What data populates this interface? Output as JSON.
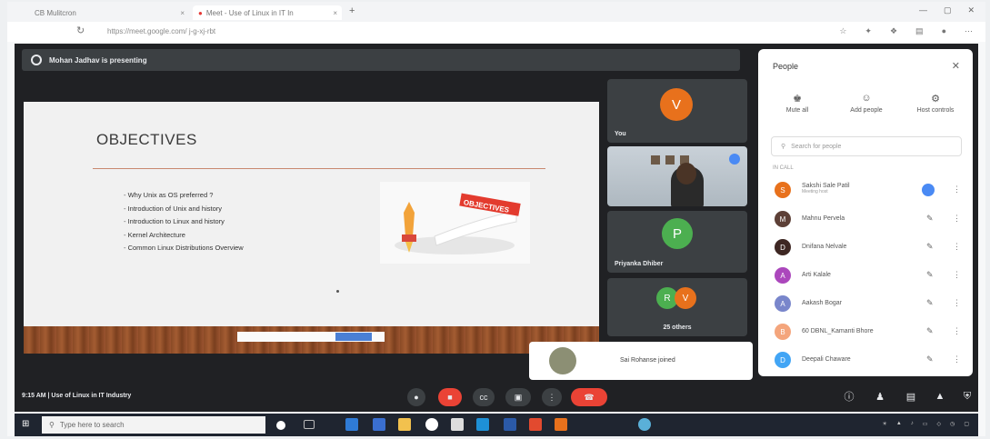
{
  "browser": {
    "tabs": [
      "CB Mulitcron",
      "Meet - Use of Linux in IT In"
    ],
    "address": "https://meet.google.com/ j-g-xj-rbt",
    "new_tab": "+"
  },
  "presenting": {
    "text": "Mohan Jadhav is presenting"
  },
  "slide": {
    "title": "OBJECTIVES",
    "bullets": [
      "Why Unix as OS preferred ?",
      "Introduction of Unix and history",
      "Introduction to Linux and history",
      "Kernel Architecture",
      "Common Linux Distributions Overview"
    ],
    "graphic_label": "OBJECTIVES"
  },
  "tiles": {
    "you": {
      "initial": "V",
      "label": "You",
      "color": "#e8711c"
    },
    "priyanka": {
      "initial": "P",
      "label": "Priyanka Dhiber",
      "color": "#4caf50"
    },
    "others": {
      "initials": [
        "R",
        "V"
      ],
      "colors": [
        "#4caf50",
        "#e8711c"
      ],
      "label": "25 others"
    }
  },
  "toast": {
    "text": "Sai Rohanse joined"
  },
  "footer": {
    "meeting": "9:15 AM  |  Use of Linux in IT Industry"
  },
  "people": {
    "title": "People",
    "actions": [
      {
        "icon": "♚",
        "label": "Mute all"
      },
      {
        "icon": "☺",
        "label": "Add people"
      },
      {
        "icon": "⚙",
        "label": "Host controls"
      }
    ],
    "search_placeholder": "Search for people",
    "section": "IN CALL",
    "participants": [
      {
        "initial": "S",
        "name": "Sakshi Sale Patil",
        "sub": "Meeting host",
        "color": "#e8711c",
        "speaking": true
      },
      {
        "initial": "M",
        "name": "Mahnu Pervela",
        "color": "#5d4037",
        "speaking": false
      },
      {
        "initial": "D",
        "name": "Dnifana Nelvale",
        "color": "#3e2723",
        "speaking": false
      },
      {
        "initial": "A",
        "name": "Arti Kalale",
        "color": "#ab47bc",
        "speaking": false
      },
      {
        "initial": "A",
        "name": "Aakash Bogar",
        "color": "#7986cb",
        "speaking": false
      },
      {
        "initial": "B",
        "name": "60 DBNL_Kamanti Bhore",
        "color": "#f4a57c",
        "speaking": false
      },
      {
        "initial": "D",
        "name": "Deepali Chaware",
        "color": "#42a5f5",
        "speaking": false
      }
    ]
  },
  "taskbar": {
    "search_placeholder": "Type here to search"
  }
}
